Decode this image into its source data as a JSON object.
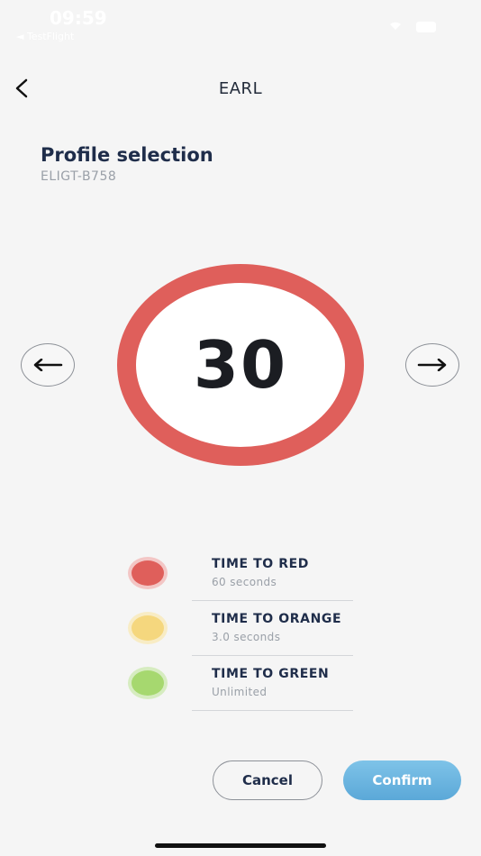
{
  "status_bar": {
    "time": "09:59",
    "back_label": "◄ TestFlight",
    "wifi_icon": "wifi-icon",
    "battery_icon": "battery-icon"
  },
  "nav": {
    "back_icon": "chevron-left-icon",
    "title": "EARL"
  },
  "header": {
    "title": "Profile selection",
    "subtitle": "ELIGT-B758"
  },
  "dial": {
    "value": "30",
    "ring_color": "#df5f5b",
    "prev_icon": "arrow-left-icon",
    "next_icon": "arrow-right-icon"
  },
  "legend": [
    {
      "title": "TIME TO RED",
      "value": "60 seconds",
      "color": "#df5f5b",
      "halo": "#f3c6c5"
    },
    {
      "title": "TIME TO ORANGE",
      "value": "3.0 seconds",
      "color": "#f5d77e",
      "halo": "#f8ecc5"
    },
    {
      "title": "TIME TO GREEN",
      "value": "Unlimited",
      "color": "#a6d86f",
      "halo": "#d6ecc0"
    }
  ],
  "actions": {
    "cancel_label": "Cancel",
    "confirm_label": "Confirm"
  }
}
